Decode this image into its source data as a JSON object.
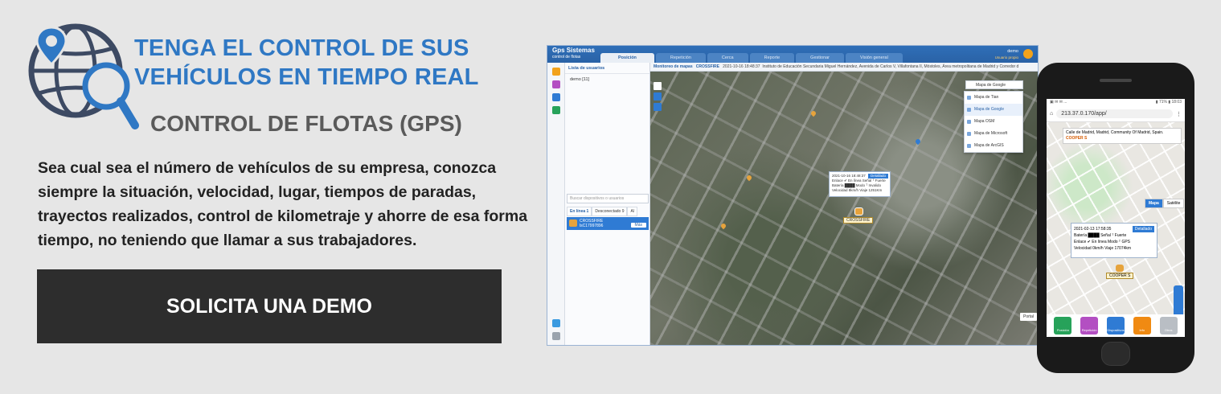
{
  "hero": {
    "title_line1": "TENGA EL CONTROL DE SUS",
    "title_line2": "VEHÍCULOS EN TIEMPO REAL",
    "subtitle": "CONTROL DE FLOTAS (GPS)",
    "description": "Sea cual sea el número de vehículos de su empresa, conozca siempre la situación,  velocidad,  lugar, tiempos de paradas, trayectos realizados, control de kilometraje y  ahorre de esa forma tiempo, no teniendo que llamar a sus trabajadores.",
    "cta_label": "SOLICITA UNA DEMO"
  },
  "colors": {
    "title_blue": "#2f78c4",
    "subtitle_gray": "#5a5a5a",
    "cta_bg": "#2d2d2d",
    "app_blue": "#2a62a6"
  },
  "desktop_app": {
    "brand": "Gps Sistemas",
    "brand_sub": "control de flotas",
    "tabs": [
      "Posición",
      "Repetición",
      "Cerca",
      "Reporte",
      "Gestionar",
      "Visión general"
    ],
    "user_name": "demo",
    "user_role": "Usuario propio",
    "user_list_title": "Lista de usuarios",
    "tree_item": "demo  [11]",
    "search_placeholder": "Buscar dispositivos o usuarios",
    "device_tabs": [
      "En línea 1",
      "Desconectado 9",
      "Al"
    ],
    "device_name": "CROSSFIRE",
    "device_id": "lsC17997896",
    "device_status": "En línea",
    "device_button": "Más",
    "map_header_title": "Monitoreo de mapas",
    "map_header_device": "CROSSFIRE",
    "map_header_time": "2021-10-16 18:48:37",
    "map_header_address": "Instituto de Educación Secundaria Miguel Hernández, Avenida de Carlos V, Villafontana II, Móstoles, Área metropolitana de Madrid y Corredor d",
    "map_type_selected": "Mapa de Google",
    "map_types": [
      "Mapa de Tian",
      "Mapa de Google",
      "Mapa OSM",
      "Mapa de Microsoft",
      "Mapa de ArcGIS"
    ],
    "popup_time": "2021-10-16 18:48:37",
    "popup_detail": "Detallado",
    "popup_rows": [
      "Enlace ✔ En línea   Señal ᵀ Fuerte",
      "Batería ████   Modo ᵀ Invalido",
      "Velocidad 8km/h   Viaje 1251Km"
    ],
    "marker_label": "CROSSFIRE",
    "portal_label": "Portal"
  },
  "phone_app": {
    "status_left": "▣ ✉ ✉ ...",
    "status_right": "▮ 71% ▮ 18:03",
    "url": "213.37.0.170/app/",
    "address": "Calle de Madrid, Madrid, Community Of Madrid, Spain.",
    "vehicle_name": "COOPER S",
    "map_toggle": [
      "Mapa",
      "Satélite"
    ],
    "popup_time": "2021-02-13 17:58:35",
    "popup_detail": "Detallado",
    "popup_rows": [
      "Batería ████   Señal ᵀ Fuerte",
      "Enlace ✔ En línea   Modo ᵀ GPS",
      "Velocidad 0km/h   Viaje 17074km"
    ],
    "marker_label": "COOPER S",
    "nav": [
      "Posición",
      "Repetición",
      "Dispositivos",
      "Info",
      "Otros"
    ],
    "footer": "Mapa de Google"
  }
}
